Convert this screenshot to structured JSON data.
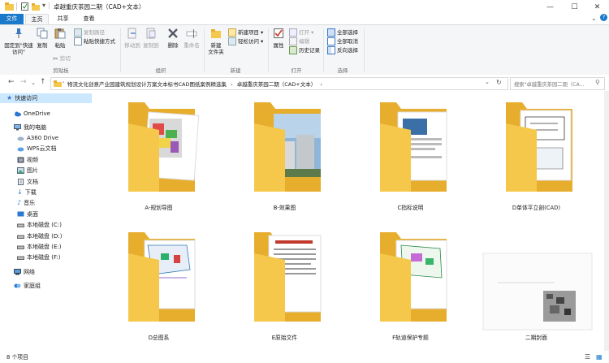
{
  "window": {
    "title": "卓越重庆茶园二期（CAD+文本）",
    "controls": {
      "minimize": "—",
      "maximize": "☐",
      "close": "✕",
      "help": "?"
    }
  },
  "tabs": {
    "file": "文件",
    "home": "主页",
    "share": "共享",
    "view": "查看"
  },
  "ribbon": {
    "clipboard": {
      "label": "剪贴板",
      "pin": "固定到\"快速访问\"",
      "copy": "复制",
      "paste": "粘贴",
      "cut": "剪切",
      "copy_path": "复制路径",
      "paste_shortcut": "粘贴快捷方式"
    },
    "organize": {
      "label": "组织",
      "move_to": "移动到",
      "copy_to": "复制到",
      "delete": "删除",
      "rename": "重命名"
    },
    "new": {
      "label": "新建",
      "new_folder": "新建\n文件夹",
      "new_item": "新建项目",
      "easy_access": "轻松访问"
    },
    "open": {
      "label": "打开",
      "properties": "属性",
      "open": "打开",
      "edit": "编辑",
      "history": "历史记录"
    },
    "select": {
      "label": "选择",
      "select_all": "全部选择",
      "select_none": "全部取消",
      "invert": "反向选择"
    }
  },
  "address": {
    "breadcrumb": [
      "物流文化创意产业园建筑规划设计方案文本标书CAD图纸案例精选集",
      "卓越重庆茶园二期（CAD+文本）"
    ],
    "search_placeholder": "搜索\"卓越重庆茶园二期（CA...",
    "refresh": "↻"
  },
  "sidebar": {
    "items": [
      {
        "label": "快速访问",
        "icon": "star-icon"
      },
      {
        "label": "OneDrive",
        "icon": "cloud-icon"
      },
      {
        "label": "我的电脑",
        "icon": "computer-icon"
      },
      {
        "label": "A360 Drive",
        "icon": "cloud-drive-icon"
      },
      {
        "label": "WPS云文档",
        "icon": "cloud-doc-icon"
      },
      {
        "label": "视频",
        "icon": "video-icon"
      },
      {
        "label": "图片",
        "icon": "picture-icon"
      },
      {
        "label": "文档",
        "icon": "document-icon"
      },
      {
        "label": "下载",
        "icon": "download-icon"
      },
      {
        "label": "音乐",
        "icon": "music-icon"
      },
      {
        "label": "桌面",
        "icon": "desktop-icon"
      },
      {
        "label": "本地磁盘 (C:)",
        "icon": "drive-icon"
      },
      {
        "label": "本地磁盘 (D:)",
        "icon": "drive-icon"
      },
      {
        "label": "本地磁盘 (E:)",
        "icon": "drive-icon"
      },
      {
        "label": "本地磁盘 (F:)",
        "icon": "drive-icon"
      },
      {
        "label": "网络",
        "icon": "network-icon"
      },
      {
        "label": "家庭组",
        "icon": "homegroup-icon"
      }
    ]
  },
  "files": [
    {
      "name": "A-规划导图",
      "type": "folder"
    },
    {
      "name": "B-效果图",
      "type": "folder"
    },
    {
      "name": "C指标说明",
      "type": "folder"
    },
    {
      "name": "D单体平立剖(CAD)",
      "type": "folder"
    },
    {
      "name": "D总图系",
      "type": "folder"
    },
    {
      "name": "E原始文件",
      "type": "folder"
    },
    {
      "name": "F轨道保护专题",
      "type": "folder"
    },
    {
      "name": "二期封面",
      "type": "image"
    }
  ],
  "status": {
    "count": "8 个项目"
  },
  "colors": {
    "accent": "#1979ca",
    "folder": "#f5c84c",
    "folder_dark": "#e7ad2c",
    "selection": "#cce8ff"
  }
}
